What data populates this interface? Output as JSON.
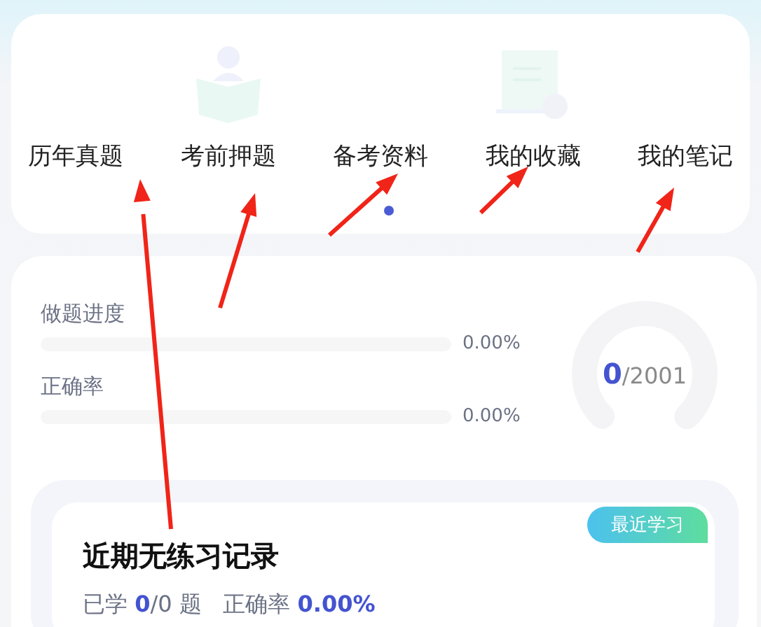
{
  "shortcuts": [
    {
      "label": "历年真题"
    },
    {
      "label": "考前押题"
    },
    {
      "label": "备考资料"
    },
    {
      "label": "我的收藏"
    },
    {
      "label": "我的笔记"
    }
  ],
  "progress": [
    {
      "label": "做题进度",
      "level": 0,
      "reading": "0.00%"
    },
    {
      "label": "正确率",
      "level": 0,
      "reading": "0.00%"
    }
  ],
  "gauge": {
    "done": "0",
    "total": "/2001"
  },
  "recent": {
    "badge": "最近学习",
    "title": "近期无练习记录",
    "stats": "已学 **0**/0 题   正确率 **0.00%**"
  }
}
